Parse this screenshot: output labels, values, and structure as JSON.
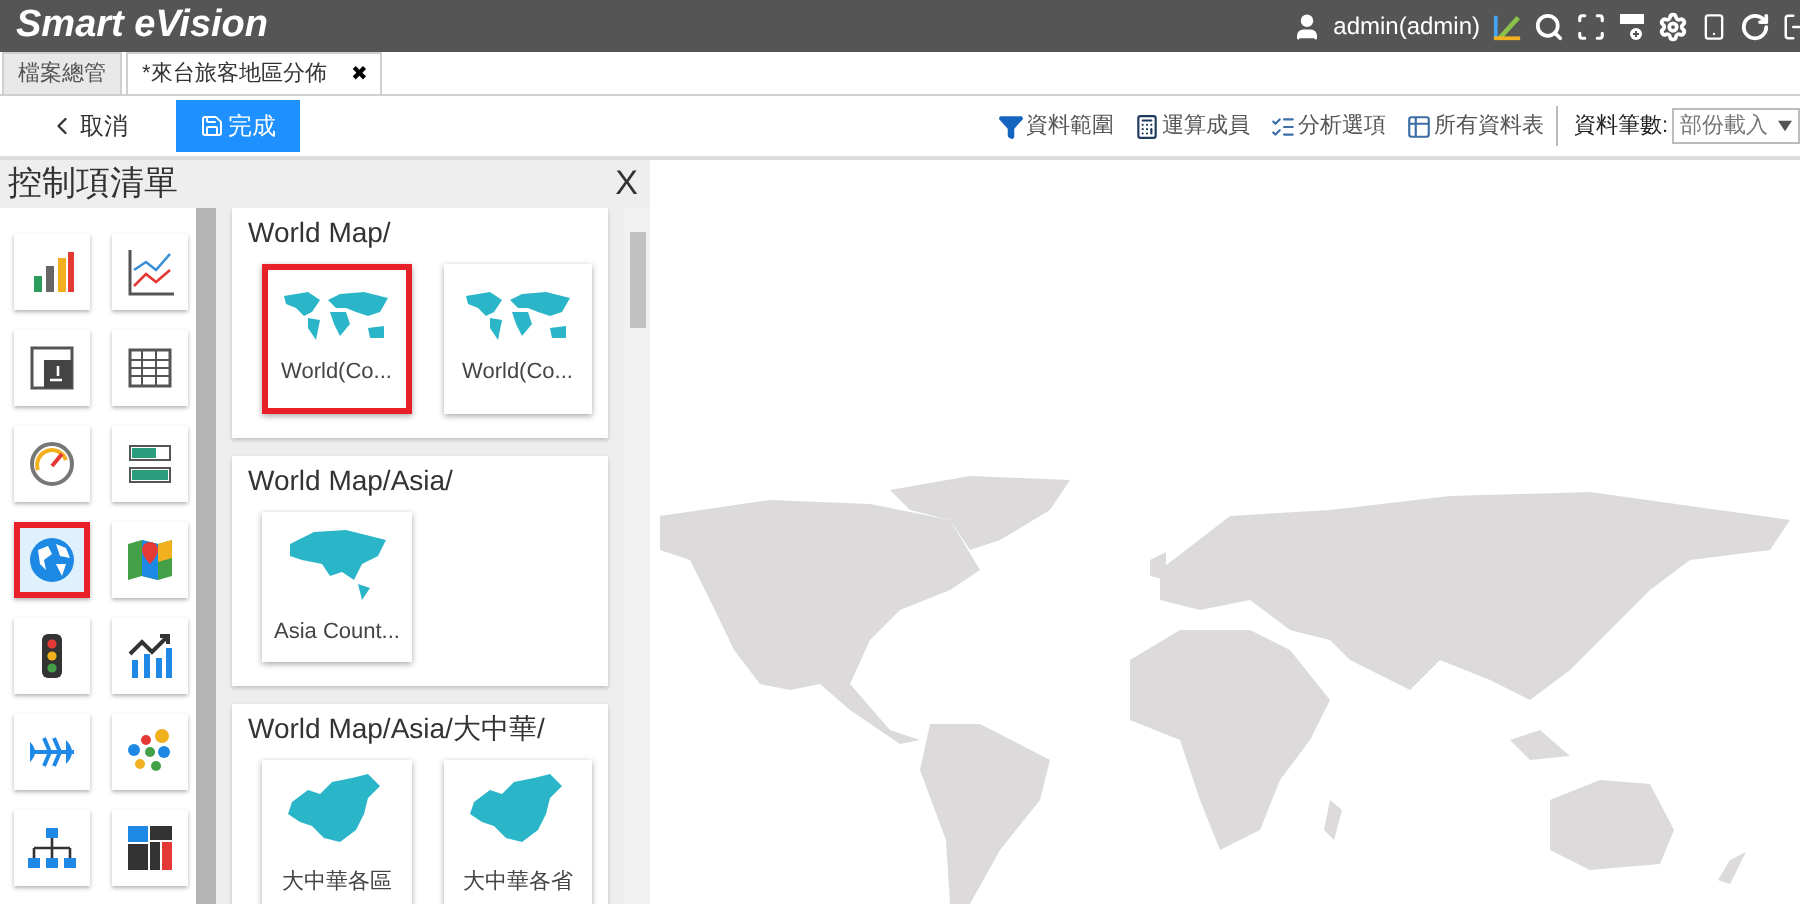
{
  "header": {
    "title": "Smart eVision",
    "user": "admin(admin)"
  },
  "tabs": [
    {
      "label": "檔案總管",
      "selected": false
    },
    {
      "label": "*來台旅客地區分佈",
      "selected": true,
      "close": "✖"
    }
  ],
  "toolbar": {
    "cancel": "取消",
    "done": "完成",
    "actions": [
      {
        "kind": "filter",
        "label": "資料範圍"
      },
      {
        "kind": "calc",
        "label": "運算成員"
      },
      {
        "kind": "options",
        "label": "分析選項"
      },
      {
        "kind": "tables",
        "label": "所有資料表"
      }
    ],
    "record_count_label": "資料筆數:",
    "record_count_value": "部份載入"
  },
  "panel": {
    "title": "控制項清單",
    "close": "X",
    "widgets": [
      {
        "kind": "bar",
        "selected": false
      },
      {
        "kind": "line",
        "selected": false
      },
      {
        "kind": "pivot",
        "selected": false
      },
      {
        "kind": "grid",
        "selected": false
      },
      {
        "kind": "gauge",
        "selected": false
      },
      {
        "kind": "progress",
        "selected": false
      },
      {
        "kind": "globe",
        "selected": true
      },
      {
        "kind": "mappin",
        "selected": false
      },
      {
        "kind": "light",
        "selected": false
      },
      {
        "kind": "trend",
        "selected": false
      },
      {
        "kind": "fish",
        "selected": false
      },
      {
        "kind": "bubbles",
        "selected": false
      },
      {
        "kind": "tree",
        "selected": false
      },
      {
        "kind": "treemap",
        "selected": false
      }
    ],
    "groups": [
      {
        "title": "World Map/",
        "items": [
          {
            "kind": "world",
            "label": "World(Co...",
            "selected": true
          },
          {
            "kind": "world",
            "label": "World(Co...",
            "selected": false
          }
        ]
      },
      {
        "title": "World Map/Asia/",
        "items": [
          {
            "kind": "asia",
            "label": "Asia Count...",
            "selected": false
          }
        ]
      },
      {
        "title": "World Map/Asia/大中華/",
        "items": [
          {
            "kind": "china",
            "label": "大中華各區",
            "selected": false
          },
          {
            "kind": "china",
            "label": "大中華各省",
            "selected": false
          }
        ]
      }
    ]
  }
}
